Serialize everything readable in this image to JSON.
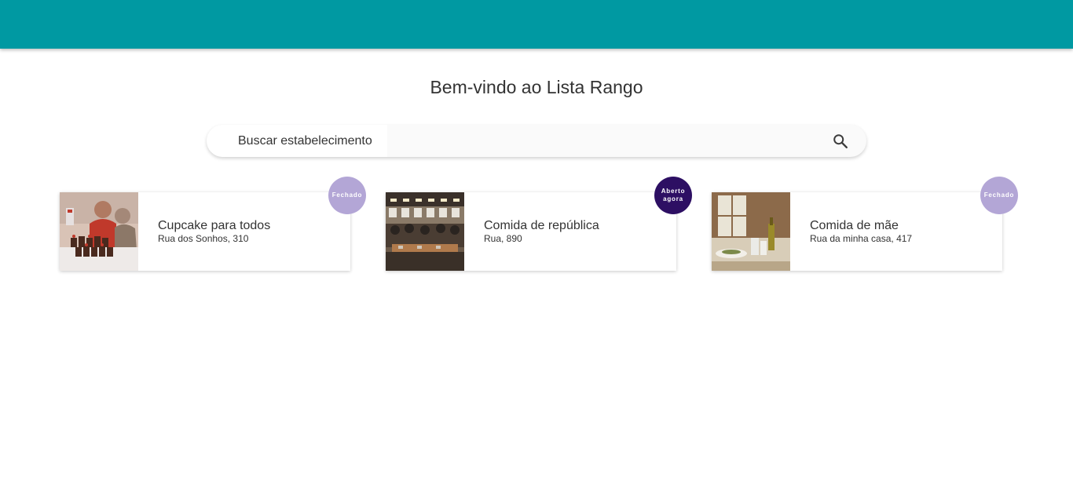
{
  "header": {
    "bar_color": "#0099a2"
  },
  "main": {
    "title": "Bem-vindo ao Lista Rango"
  },
  "search": {
    "label": "Buscar estabelecimento",
    "value": "",
    "placeholder": "",
    "icon": "search-icon"
  },
  "restaurants": [
    {
      "name": "Cupcake para todos",
      "address": "Rua dos Sonhos, 310",
      "status": "Fechado",
      "status_color": "#b3a6d6",
      "image": "cupcakes-photo"
    },
    {
      "name": "Comida de república",
      "address": "Rua, 890",
      "status": "Aberto agora",
      "status_color": "#2d0f63",
      "image": "restaurant-interior-photo"
    },
    {
      "name": "Comida de mãe",
      "address": "Rua da minha casa, 417",
      "status": "Fechado",
      "status_color": "#b3a6d6",
      "image": "table-setting-photo"
    }
  ]
}
